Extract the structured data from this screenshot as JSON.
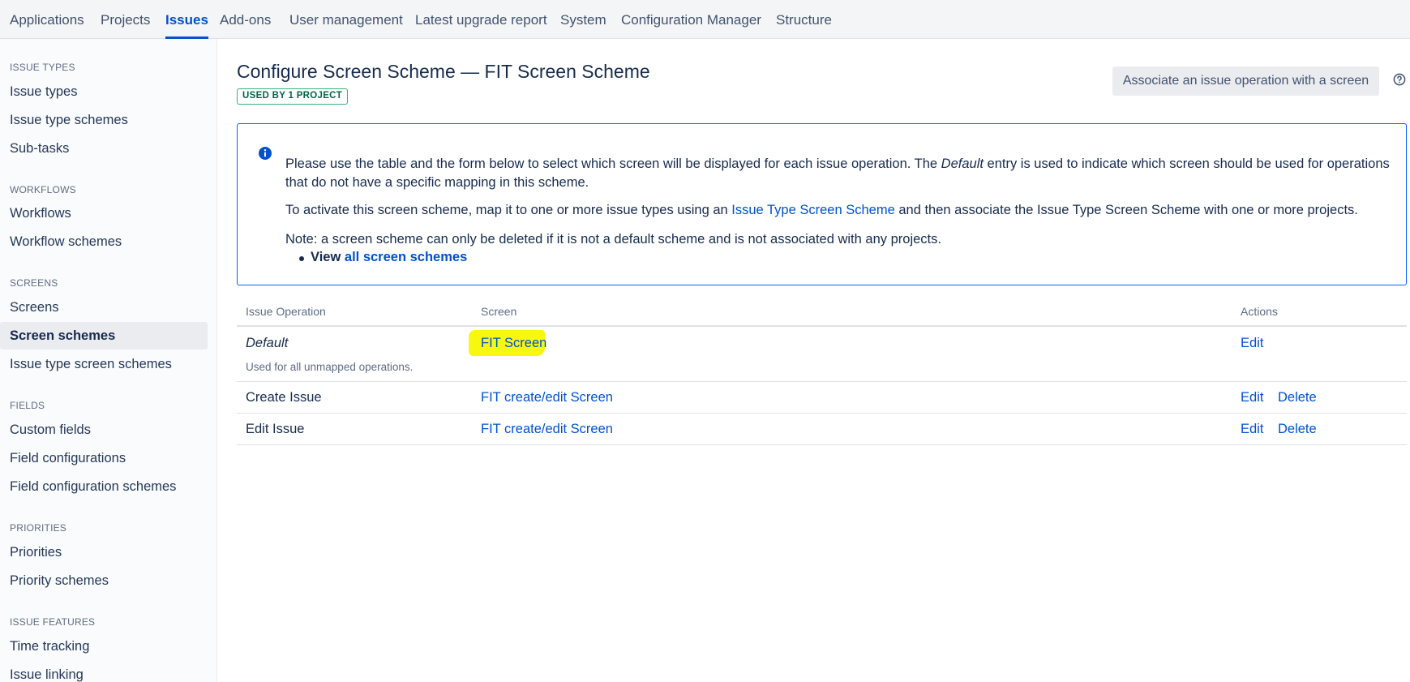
{
  "nav": {
    "tabs": [
      {
        "label": "Applications"
      },
      {
        "label": "Projects"
      },
      {
        "label": "Issues"
      },
      {
        "label": "Add-ons"
      },
      {
        "label": "User management"
      },
      {
        "label": "Latest upgrade report"
      },
      {
        "label": "System"
      },
      {
        "label": "Configuration Manager"
      },
      {
        "label": "Structure"
      }
    ],
    "active": "Issues"
  },
  "sidebar": {
    "sections": [
      {
        "heading": "ISSUE TYPES",
        "items": [
          "Issue types",
          "Issue type schemes",
          "Sub-tasks"
        ]
      },
      {
        "heading": "WORKFLOWS",
        "items": [
          "Workflows",
          "Workflow schemes"
        ]
      },
      {
        "heading": "SCREENS",
        "items": [
          "Screens",
          "Screen schemes",
          "Issue type screen schemes"
        ]
      },
      {
        "heading": "FIELDS",
        "items": [
          "Custom fields",
          "Field configurations",
          "Field configuration schemes"
        ]
      },
      {
        "heading": "PRIORITIES",
        "items": [
          "Priorities",
          "Priority schemes"
        ]
      },
      {
        "heading": "ISSUE FEATURES",
        "items": [
          "Time tracking",
          "Issue linking"
        ]
      }
    ],
    "selected": "Screen schemes"
  },
  "page": {
    "title": "Configure Screen Scheme — FIT Screen Scheme",
    "lozenge": "USED BY 1 PROJECT",
    "associate_button": "Associate an issue operation with a screen"
  },
  "info": {
    "p1_before": "Please use the table and the form below to select which screen will be displayed for each issue operation. The ",
    "p1_em": "Default",
    "p1_after_line1": " entry is used to indicate which screen should be used for operations",
    "p1_line2": "that do not have a specific mapping in this scheme.",
    "p2_before": "To activate this screen scheme, map it to one or more issue types using an ",
    "p2_link": "Issue Type Screen Scheme",
    "p2_after": " and then associate the Issue Type Screen Scheme with one or more projects.",
    "p3": "Note: a screen scheme can only be deleted if it is not a default scheme and is not associated with any projects.",
    "bullet_prefix": "View ",
    "bullet_link": "all screen schemes"
  },
  "table": {
    "headers": {
      "operation": "Issue Operation",
      "screen": "Screen",
      "actions": "Actions"
    },
    "rows": [
      {
        "operation": "Default",
        "subtext": "Used for all unmapped operations.",
        "screen": "FIT Screen",
        "edit": "Edit"
      },
      {
        "operation": "Create Issue",
        "screen": "FIT create/edit Screen",
        "edit": "Edit",
        "delete": "Delete"
      },
      {
        "operation": "Edit Issue",
        "screen": "FIT create/edit Screen",
        "edit": "Edit",
        "delete": "Delete"
      }
    ]
  },
  "colors": {
    "accent": "#0052cc",
    "highlight": "#f8f80e",
    "lozenge_border": "#36b37e",
    "info_border": "#0065ff"
  }
}
